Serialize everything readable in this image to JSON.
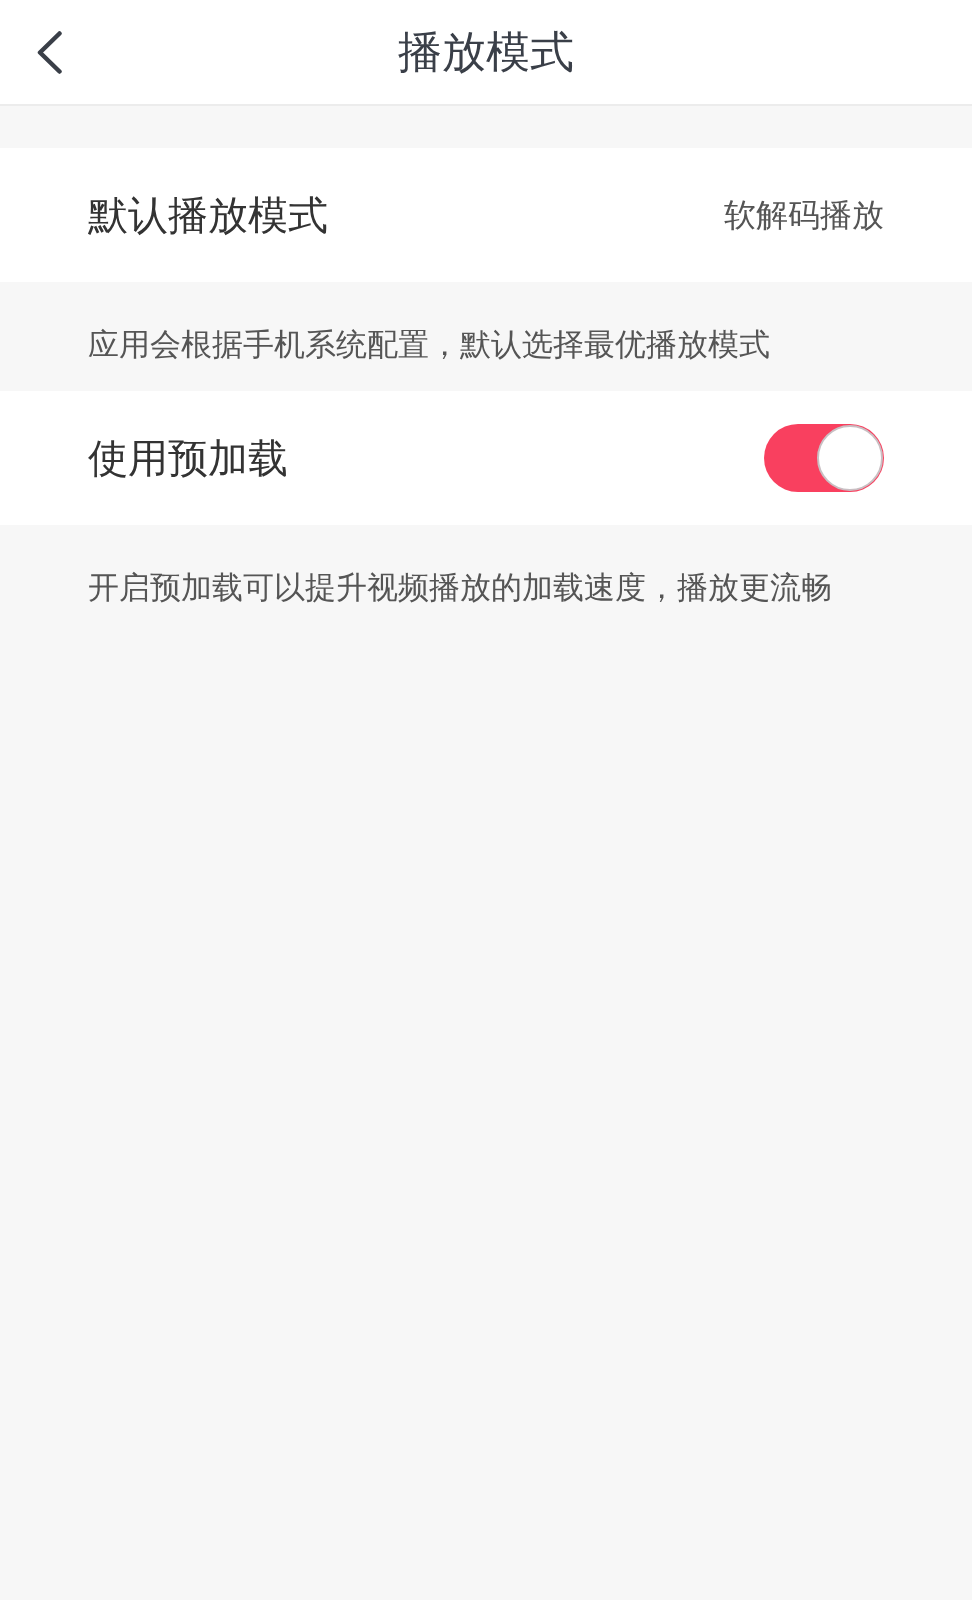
{
  "header": {
    "title": "播放模式"
  },
  "settings": [
    {
      "kind": "value",
      "label": "默认播放模式",
      "value": "软解码播放",
      "description": "应用会根据手机系统配置，默认选择最优播放模式"
    },
    {
      "kind": "toggle",
      "label": "使用预加载",
      "on": true,
      "description": "开启预加载可以提升视频播放的加载速度，播放更流畅"
    }
  ]
}
